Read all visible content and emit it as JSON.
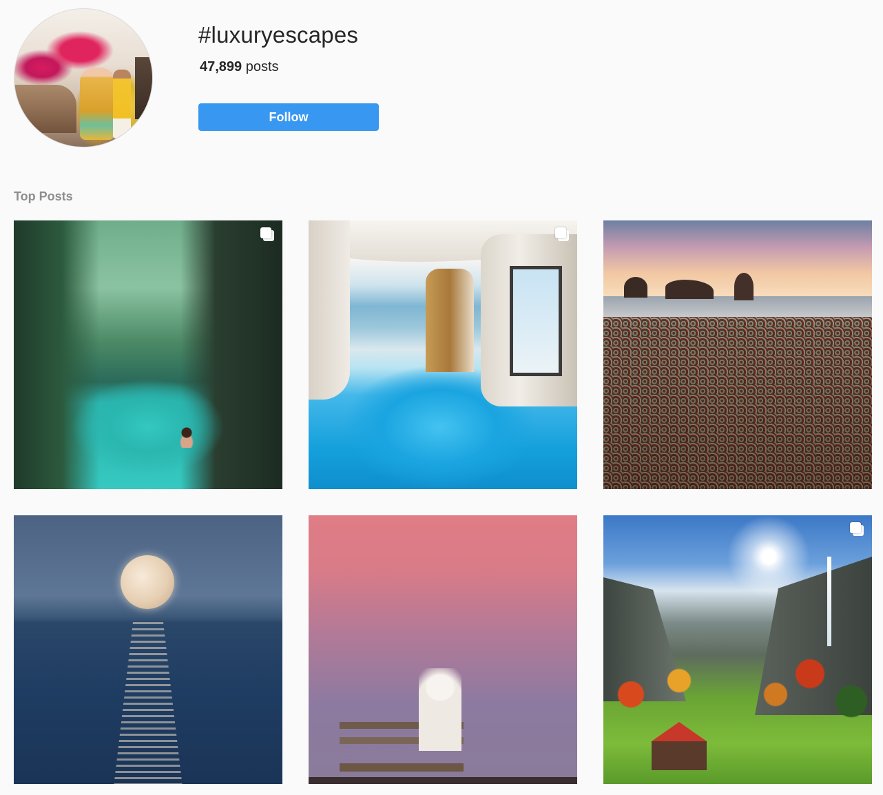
{
  "header": {
    "hashtag": "#luxuryescapes",
    "post_count": "47,899",
    "post_count_suffix": " posts",
    "follow_label": "Follow"
  },
  "section": {
    "title": "Top Posts"
  },
  "posts": [
    {
      "id": "post-1",
      "subject": "canyon-lagoon",
      "multi": true
    },
    {
      "id": "post-2",
      "subject": "cave-pool",
      "multi": true
    },
    {
      "id": "post-3",
      "subject": "glass-beach",
      "multi": false
    },
    {
      "id": "post-4",
      "subject": "full-moon-sea",
      "multi": false
    },
    {
      "id": "post-5",
      "subject": "dog-on-bench",
      "multi": false
    },
    {
      "id": "post-6",
      "subject": "alpine-valley",
      "multi": true
    }
  ],
  "colors": {
    "follow_button": "#3897f0",
    "background": "#fafafa",
    "label_gray": "#8e8e8e",
    "text": "#262626"
  },
  "icons": {
    "multi": "multiple-photos-icon"
  }
}
